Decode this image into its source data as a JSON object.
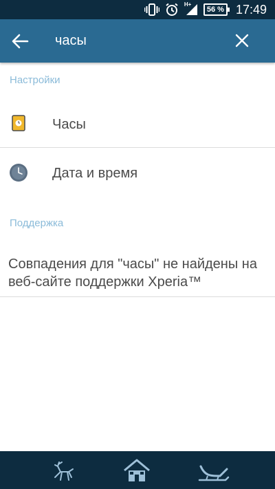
{
  "status_bar": {
    "icons": [
      "vibrate-icon",
      "alarm-icon",
      "signal-icon",
      "battery-icon"
    ],
    "network_label": "H+",
    "battery": "56 %",
    "time": "17:49"
  },
  "search": {
    "query": "часы",
    "back_icon": "arrow-left-icon",
    "clear_icon": "close-icon"
  },
  "sections": {
    "settings": {
      "header": "Настройки",
      "items": [
        {
          "label": "Часы",
          "icon": "clock-widget-icon"
        },
        {
          "label": "Дата и время",
          "icon": "analog-clock-icon"
        }
      ]
    },
    "support": {
      "header": "Поддержка",
      "message": "Совпадения для \"часы\" не найдены на веб-сайте поддержки Xperia™"
    }
  },
  "nav_bar": {
    "icons": [
      "reindeer-back-icon",
      "house-home-icon",
      "sleigh-recents-icon"
    ]
  },
  "colors": {
    "status_bar_bg": "#0d2c40",
    "search_bar_bg": "#2a6a92",
    "section_header": "#8bbbd9",
    "text": "#4a4a4a",
    "nav_bar_bg": "#0d2c40"
  }
}
